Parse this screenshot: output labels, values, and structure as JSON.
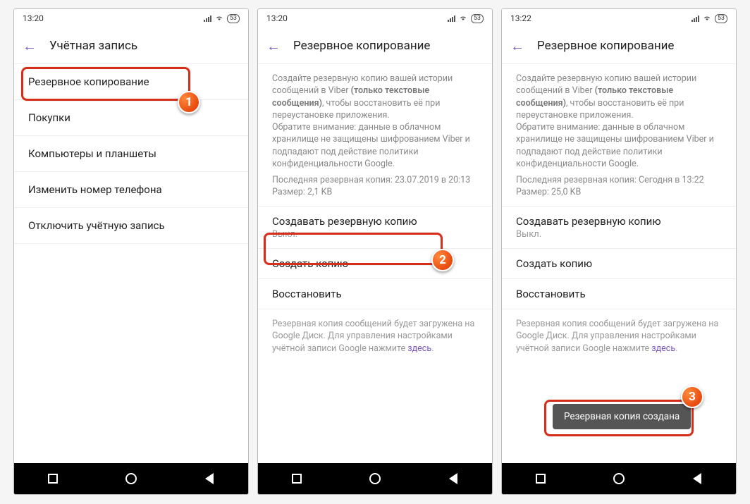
{
  "status": {
    "battery": "53"
  },
  "screens": [
    {
      "time": "13:20",
      "title": "Учётная запись",
      "menu": [
        "Резервное копирование",
        "Покупки",
        "Компьютеры и планшеты",
        "Изменить номер телефона",
        "Отключить учётную запись"
      ],
      "badge": "1"
    },
    {
      "time": "13:20",
      "title": "Резервное копирование",
      "info1a": "Создайте резервную копию вашей истории сообщений в Viber ",
      "info1b": "(только текстовые сообщения)",
      "info1c": ", чтобы восстановить её при переустановке приложения.",
      "info2": "Обратите внимание: данные в облачном хранилище не защищены шифрованием Viber и подпадают под действие политики конфиденциальности Google.",
      "last": "Последняя резервная копия: 23.07.2019 в 20:13",
      "size": "Размер: 2,1 KB",
      "auto_title": "Создавать резервную копию",
      "auto_value": "Выкл.",
      "create": "Создать копию",
      "restore": "Восстановить",
      "footer_a": "Резервная копия сообщений будет загружена на Google Диск. Для управления настройками учётной записи Google нажмите ",
      "footer_link": "здесь",
      "badge": "2"
    },
    {
      "time": "13:22",
      "title": "Резервное копирование",
      "info1a": "Создайте резервную копию вашей истории сообщений в Viber ",
      "info1b": "(только текстовые сообщения)",
      "info1c": ", чтобы восстановить её при переустановке приложения.",
      "info2": "Обратите внимание: данные в облачном хранилище не защищены шифрованием Viber и подпадают под действие политики конфиденциальности Google.",
      "last": "Последняя резервная копия: Сегодня в 13:22",
      "size": "Размер: 25,0 KB",
      "auto_title": "Создавать резервную копию",
      "auto_value": "Выкл.",
      "create": "Создать копию",
      "restore": "Восстановить",
      "footer_a": "Резервная копия сообщений будет загружена на Google Диск. Для управления настройками учётной записи Google нажмите ",
      "footer_link": "здесь",
      "toast": "Резервная копия создана",
      "badge": "3"
    }
  ]
}
